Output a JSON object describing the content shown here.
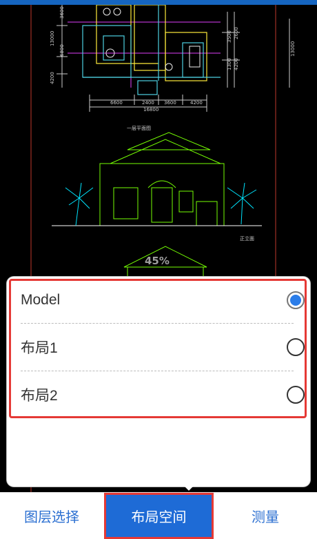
{
  "viewer": {
    "zoom_label": "45%",
    "drawing_labels": {
      "plan_title": "一层平面图",
      "elevation_title": "正立面",
      "dims_bottom": [
        "6600",
        "2400",
        "3600",
        "4200",
        "16800"
      ],
      "dims_left": [
        "13000",
        "6800",
        "3600",
        "4200"
      ],
      "dims_right": [
        "2600",
        "4200",
        "13000",
        "1300",
        "3500"
      ]
    }
  },
  "layout_panel": {
    "options": [
      {
        "label": "Model",
        "selected": true
      },
      {
        "label": "布局1",
        "selected": false
      },
      {
        "label": "布局2",
        "selected": false
      }
    ]
  },
  "bottom_tabs": [
    {
      "label": "图层选择",
      "active": false
    },
    {
      "label": "布局空间",
      "active": true
    },
    {
      "label": "测量",
      "active": false
    }
  ],
  "colors": {
    "accent": "#1e6bd6",
    "highlight": "#e53935",
    "radio_selected": "#2b7de9"
  }
}
